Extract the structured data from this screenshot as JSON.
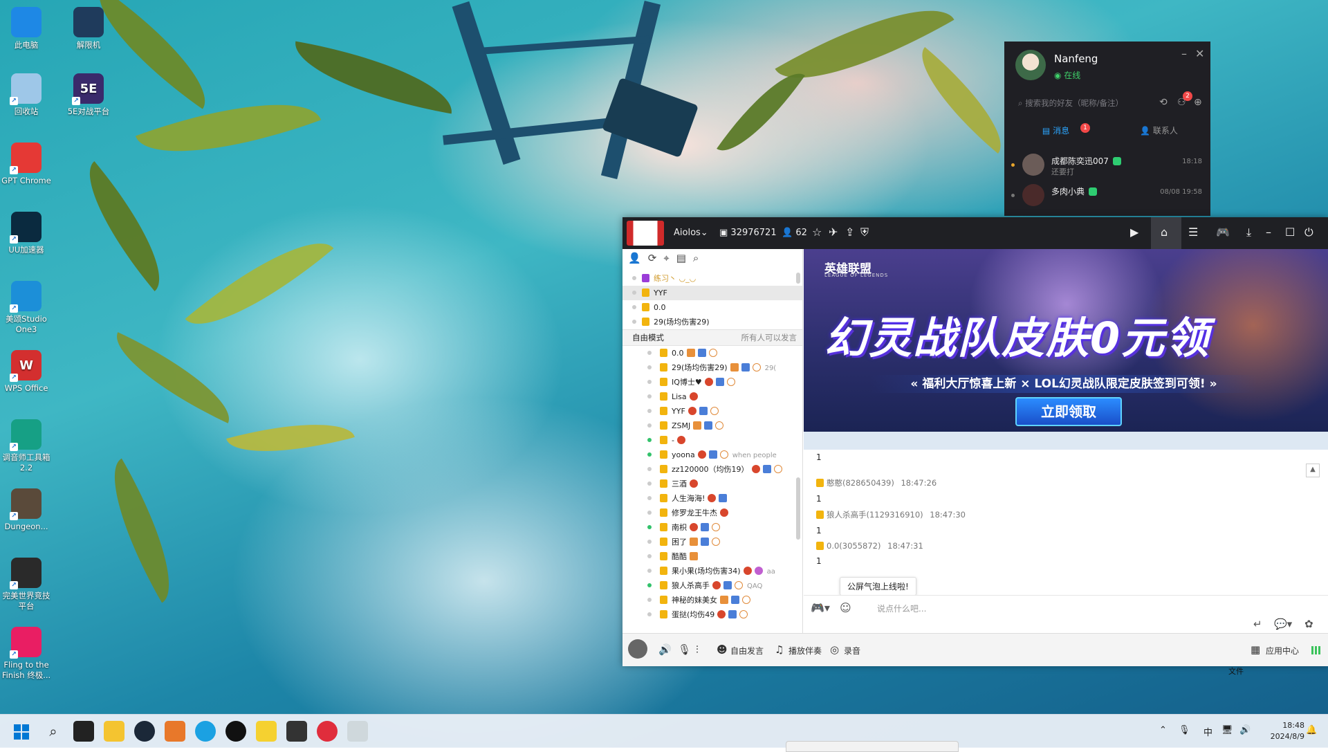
{
  "desktop_icons": [
    {
      "label": "此电脑",
      "icon": "monitor-icon",
      "color": "#1e88e5"
    },
    {
      "label": "解限机",
      "icon": "mecha-game-icon",
      "color": "#1f3b5c"
    },
    {
      "label": "回收站",
      "icon": "recycle-bin-icon",
      "color": "#9ec7e8"
    },
    {
      "label": "5E对战平台",
      "icon": "5e-platform-icon",
      "color": "#3a2a6b",
      "glyph": "5E"
    },
    {
      "label": "GPT Chrome",
      "icon": "chrome-icon",
      "color": "#e53935"
    },
    {
      "label": "UU加速器",
      "icon": "uu-accelerator-icon",
      "color": "#0a2a3f"
    },
    {
      "label": "美颂Studio One3",
      "icon": "studio-one-icon",
      "color": "#1c8fd8"
    },
    {
      "label": "WPS Office",
      "icon": "wps-office-icon",
      "color": "#d32f2f",
      "glyph": "W"
    },
    {
      "label": "调音师工具箱2.2",
      "icon": "toolbox-icon",
      "color": "#16a085"
    },
    {
      "label": "Dungeon...",
      "icon": "dungeon-icon",
      "color": "#5a4a3a"
    },
    {
      "label": "完美世界竞技平台",
      "icon": "perfect-world-icon",
      "color": "#2a2a2a"
    },
    {
      "label": "Fling to the Finish 终极...",
      "icon": "fling-game-icon",
      "color": "#e91e63"
    }
  ],
  "qq": {
    "name": "Nanfeng",
    "status": "在线",
    "search_placeholder": "搜索我的好友（昵称/备注）",
    "notif_badge": "2",
    "tabs": [
      {
        "label": "消息",
        "badge": "1"
      },
      {
        "label": "联系人"
      }
    ],
    "conversations": [
      {
        "name": "成都陈奕迅007",
        "preview": "还要打",
        "time": "18:18"
      },
      {
        "name": "多肉小典",
        "preview": "",
        "time": "08/08 19:58"
      }
    ]
  },
  "yy": {
    "channel_name": "Aiolos",
    "channel_id": "32976721",
    "online_count": "62",
    "channels": [
      {
        "label": "练习丶 ◡_◡",
        "gift": "purple",
        "selected": false
      },
      {
        "label": "YYF",
        "gift": "gold",
        "selected": true
      },
      {
        "label": "0.0",
        "gift": "gold",
        "selected": false
      },
      {
        "label": "29(场均伤害29)",
        "gift": "gold",
        "selected": false
      }
    ],
    "mode_label": "自由模式",
    "mode_hint": "所有人可以发言",
    "users": [
      {
        "name": "0.0",
        "online": false,
        "medals": [
          "o",
          "b",
          "c"
        ],
        "suffix": ""
      },
      {
        "name": "29(场均伤害29)",
        "online": false,
        "medals": [
          "o",
          "b",
          "c"
        ],
        "suffix": "29("
      },
      {
        "name": "IQ博士♥",
        "online": false,
        "medals": [
          "r",
          "b",
          "c"
        ],
        "suffix": ""
      },
      {
        "name": "Lisa",
        "online": false,
        "medals": [
          "r"
        ],
        "suffix": ""
      },
      {
        "name": "YYF",
        "online": false,
        "medals": [
          "r",
          "b",
          "c"
        ],
        "suffix": ""
      },
      {
        "name": "ZSMJ",
        "online": false,
        "medals": [
          "o",
          "b",
          "c"
        ],
        "suffix": ""
      },
      {
        "name": "-",
        "online": true,
        "medals": [
          "r"
        ],
        "suffix": ""
      },
      {
        "name": "yoona",
        "online": true,
        "medals": [
          "r",
          "b",
          "c"
        ],
        "suffix": "when people"
      },
      {
        "name": "zz120000（均伤19）",
        "online": false,
        "medals": [
          "r",
          "b",
          "c"
        ],
        "suffix": ""
      },
      {
        "name": "三酒",
        "online": false,
        "medals": [
          "r"
        ],
        "suffix": ""
      },
      {
        "name": "人生海海!",
        "online": false,
        "medals": [
          "r",
          "b"
        ],
        "suffix": ""
      },
      {
        "name": "修罗龙王牛杰",
        "online": false,
        "medals": [
          "r"
        ],
        "suffix": ""
      },
      {
        "name": "南枳",
        "online": true,
        "medals": [
          "r",
          "b",
          "c"
        ],
        "suffix": ""
      },
      {
        "name": "困了",
        "online": false,
        "medals": [
          "o",
          "b",
          "c"
        ],
        "suffix": ""
      },
      {
        "name": "酷酷",
        "online": false,
        "medals": [
          "o"
        ],
        "suffix": ""
      },
      {
        "name": "果小果(场均伤害34)",
        "online": false,
        "medals": [
          "r",
          "p"
        ],
        "suffix": "aa"
      },
      {
        "name": "狼人杀高手",
        "online": true,
        "medals": [
          "r",
          "b",
          "c"
        ],
        "suffix": "QAQ"
      },
      {
        "name": "神秘的妹美女",
        "online": false,
        "medals": [
          "o",
          "b",
          "c"
        ],
        "suffix": ""
      },
      {
        "name": "蛋挞(均伤49",
        "online": false,
        "medals": [
          "r",
          "b",
          "c"
        ],
        "suffix": ""
      }
    ],
    "banner": {
      "brand": "英雄联盟",
      "brand_sub": "LEAGUE OF LEGENDS",
      "headline": "幻灵战队皮肤0元领",
      "subline": "« 福利大厅惊喜上新 × LOL幻灵战队限定皮肤签到可领! »",
      "cta": "立即领取"
    },
    "messages": [
      {
        "sender": "",
        "time": "",
        "text": "1"
      },
      {
        "sender": "憨憨(828650439)",
        "time": "18:47:26",
        "text": "1"
      },
      {
        "sender": "狼人杀高手(1129316910)",
        "time": "18:47:30",
        "text": "1"
      },
      {
        "sender": "0.0(3055872)",
        "time": "18:47:31",
        "text": "1"
      }
    ],
    "tooltip": "公屏气泡上线啦!",
    "input_placeholder": "说点什么吧...",
    "bottom": {
      "free_speak": "自由发言",
      "play_music": "播放伴奏",
      "record": "录音",
      "app_center": "应用中心",
      "files": "文件"
    }
  },
  "taskbar": {
    "ime": "中",
    "time": "18:48",
    "date": "2024/8/9"
  },
  "colors": {
    "qq_bg": "#1f1f24",
    "qq_accent": "#2ba6ff",
    "yy_titlebar": "#1f2024",
    "online_green": "#33c26b"
  }
}
